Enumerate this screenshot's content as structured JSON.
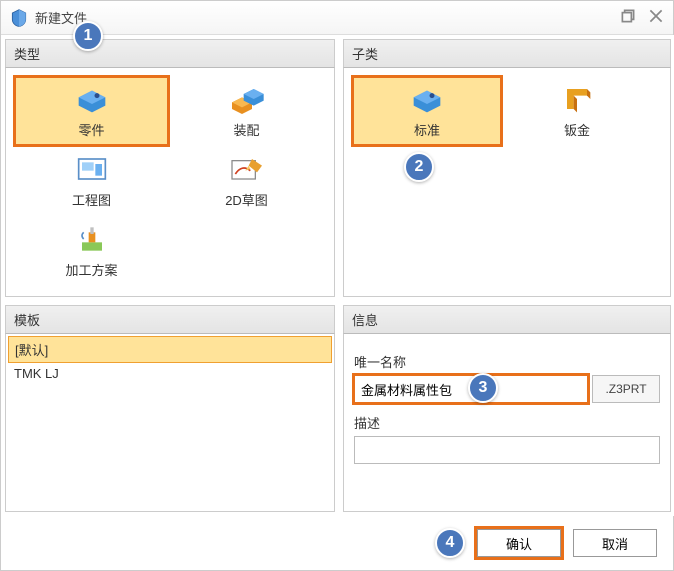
{
  "title": "新建文件",
  "sections": {
    "type": "类型",
    "subtype": "子类",
    "template": "模板",
    "info": "信息"
  },
  "types": [
    {
      "label": "零件",
      "icon": "part"
    },
    {
      "label": "装配",
      "icon": "assembly"
    },
    {
      "label": "工程图",
      "icon": "drawing"
    },
    {
      "label": "2D草图",
      "icon": "sketch"
    },
    {
      "label": "加工方案",
      "icon": "cam"
    }
  ],
  "subtypes": [
    {
      "label": "标准",
      "icon": "part"
    },
    {
      "label": "钣金",
      "icon": "sheetmetal"
    }
  ],
  "templates": [
    {
      "label": "[默认]"
    },
    {
      "label": "TMK LJ"
    }
  ],
  "info": {
    "unique_name_label": "唯一名称",
    "unique_name_value": "金属材料属性包",
    "extension": ".Z3PRT",
    "desc_label": "描述",
    "desc_value": ""
  },
  "buttons": {
    "ok": "确认",
    "cancel": "取消"
  },
  "badges": {
    "b1": "1",
    "b2": "2",
    "b3": "3",
    "b4": "4"
  }
}
